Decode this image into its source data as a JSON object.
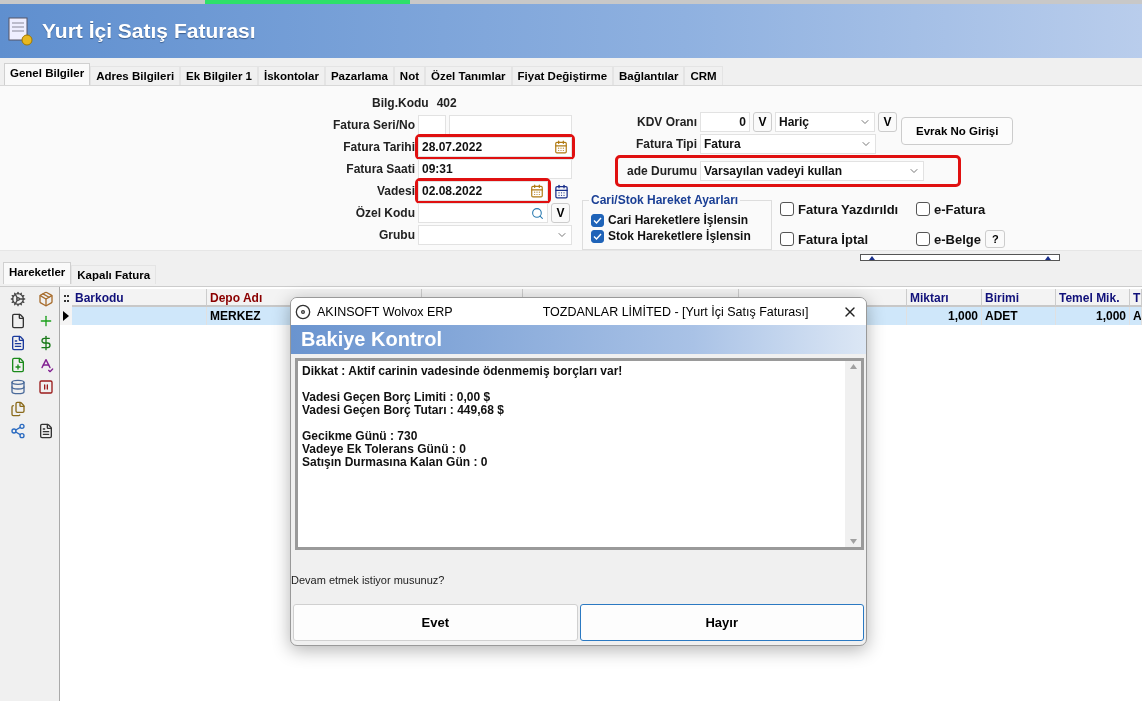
{
  "header": {
    "title": "Yurt İçi Satış Faturası"
  },
  "tabs": [
    {
      "label": "Genel Bilgiler",
      "selected": true
    },
    {
      "label": "Adres Bilgileri",
      "selected": false
    },
    {
      "label": "Ek Bilgiler 1",
      "selected": false
    },
    {
      "label": "İskontolar",
      "selected": false
    },
    {
      "label": "Pazarlama",
      "selected": false
    },
    {
      "label": "Not",
      "selected": false
    },
    {
      "label": "Özel Tanımlar",
      "selected": false
    },
    {
      "label": "Fiyat Değiştirme",
      "selected": false
    },
    {
      "label": "Bağlantılar",
      "selected": false
    },
    {
      "label": "CRM",
      "selected": false
    }
  ],
  "form": {
    "bilg_kodu": {
      "label": "Bilg.Kodu",
      "value": "402"
    },
    "left_fields": [
      {
        "kind": "split",
        "label": "Fatura Seri/No"
      },
      {
        "kind": "date",
        "label": "Fatura Tarihi",
        "value": "28.07.2022",
        "highlighted": true
      },
      {
        "kind": "text",
        "label": "Fatura Saati",
        "value": "09:31"
      },
      {
        "kind": "date",
        "label": "Vadesi",
        "value": "02.08.2022",
        "highlighted": true,
        "calendar_button": true
      },
      {
        "kind": "lookup",
        "label": "Özel Kodu",
        "button": "V"
      },
      {
        "kind": "select",
        "label": "Grubu"
      }
    ],
    "kdv": {
      "label": "KDV Oranı",
      "value": "0",
      "button": "V",
      "select": "Hariç",
      "select_button": "V"
    },
    "fatura_tipi": {
      "label": "Fatura Tipi",
      "value": "Fatura"
    },
    "vade_durumu": {
      "label": "ade Durumu",
      "value": "Varsayılan vadeyi kullan",
      "highlighted": true
    },
    "evrak_button": "Evrak No Girişi",
    "group_box": {
      "title": "Cari/Stok Hareket Ayarları",
      "items": [
        {
          "label": "Cari Hareketlere İşlensin",
          "checked": true
        },
        {
          "label": "Stok Hareketlere İşlensin",
          "checked": true
        }
      ]
    },
    "flags": [
      {
        "label": "Fatura Yazdırıldı",
        "checked": false
      },
      {
        "label": "e-Fatura",
        "checked": false
      },
      {
        "label": "Fatura İptal",
        "checked": false
      },
      {
        "label": "e-Belge",
        "checked": false
      }
    ],
    "help_button": "?"
  },
  "lower_tabs": [
    {
      "label": "Hareketler",
      "selected": true
    },
    {
      "label": "Kapalı Fatura",
      "selected": false
    }
  ],
  "grid": {
    "columns": [
      {
        "label": "Barkodu",
        "kind": "text"
      },
      {
        "label": "Depo Adı",
        "kind": "required"
      },
      {
        "kind": "number"
      },
      {
        "kind": "text"
      },
      {
        "kind": "text"
      },
      {
        "label": "Miktarı",
        "kind": "number"
      },
      {
        "label": "Birimi",
        "kind": "text"
      },
      {
        "label": "Temel Mik.",
        "kind": "number"
      },
      {
        "label": "T",
        "kind": "text"
      }
    ],
    "rows": [
      {
        "selected": true,
        "cells": [
          null,
          "MERKEZ",
          null,
          null,
          null,
          "1,000",
          "ADET",
          "1,000",
          "A"
        ]
      }
    ]
  },
  "dialog": {
    "app": "AKINSOFT Wolvox ERP",
    "title": "TOZDANLAR LİMİTED - [Yurt İçi Satış Faturası]",
    "heading": "Bakiye Kontrol",
    "message_groups": [
      [
        "Dikkat : Aktif carinin vadesinde ödenmemiş borçları var!"
      ],
      [
        "Vadesi Geçen Borç Limiti : 0,00 $",
        "Vadesi Geçen Borç Tutarı : 449,68 $"
      ],
      [
        "Gecikme Günü : 730",
        "Vadeye Ek Tolerans Günü : 0",
        "Satışın Durmasına Kalan Gün : 0"
      ]
    ],
    "question": "Devam etmek istiyor musunuz?",
    "buttons": [
      {
        "label": "Evet",
        "selected": false
      },
      {
        "label": "Hayır",
        "selected": true
      }
    ]
  }
}
